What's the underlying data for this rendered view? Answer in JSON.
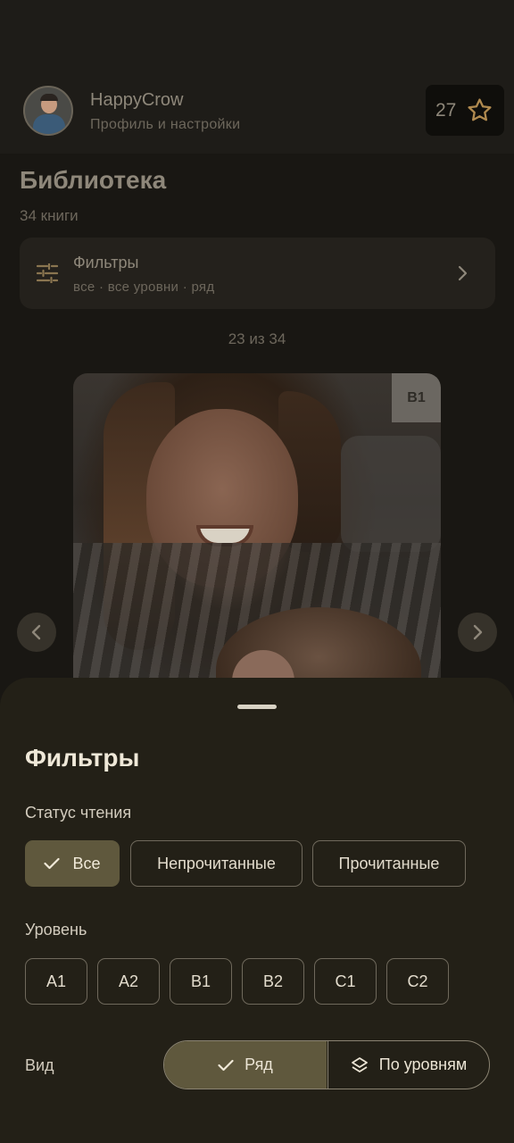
{
  "header": {
    "user_name": "HappyCrow",
    "user_subtitle": "Профиль и настройки",
    "stars": "27"
  },
  "library": {
    "title": "Библиотека",
    "count": "34 книги",
    "filters_title": "Фильтры",
    "filters_summary": "все · все уровни · ряд",
    "pager": "23 из 34",
    "book_level": "B1"
  },
  "sheet": {
    "title": "Фильтры",
    "status_label": "Статус чтения",
    "status_options": [
      "Все",
      "Непрочитанные",
      "Прочитанные"
    ],
    "status_selected": "Все",
    "level_label": "Уровень",
    "level_options": [
      "A1",
      "A2",
      "B1",
      "B2",
      "C1",
      "C2"
    ],
    "view_label": "Вид",
    "view_options": [
      "Ряд",
      "По уровням"
    ],
    "view_selected": "Ряд"
  },
  "colors": {
    "background": "#191713",
    "sheet": "#232017",
    "accent": "#5f583d",
    "star": "#b08a4f"
  }
}
